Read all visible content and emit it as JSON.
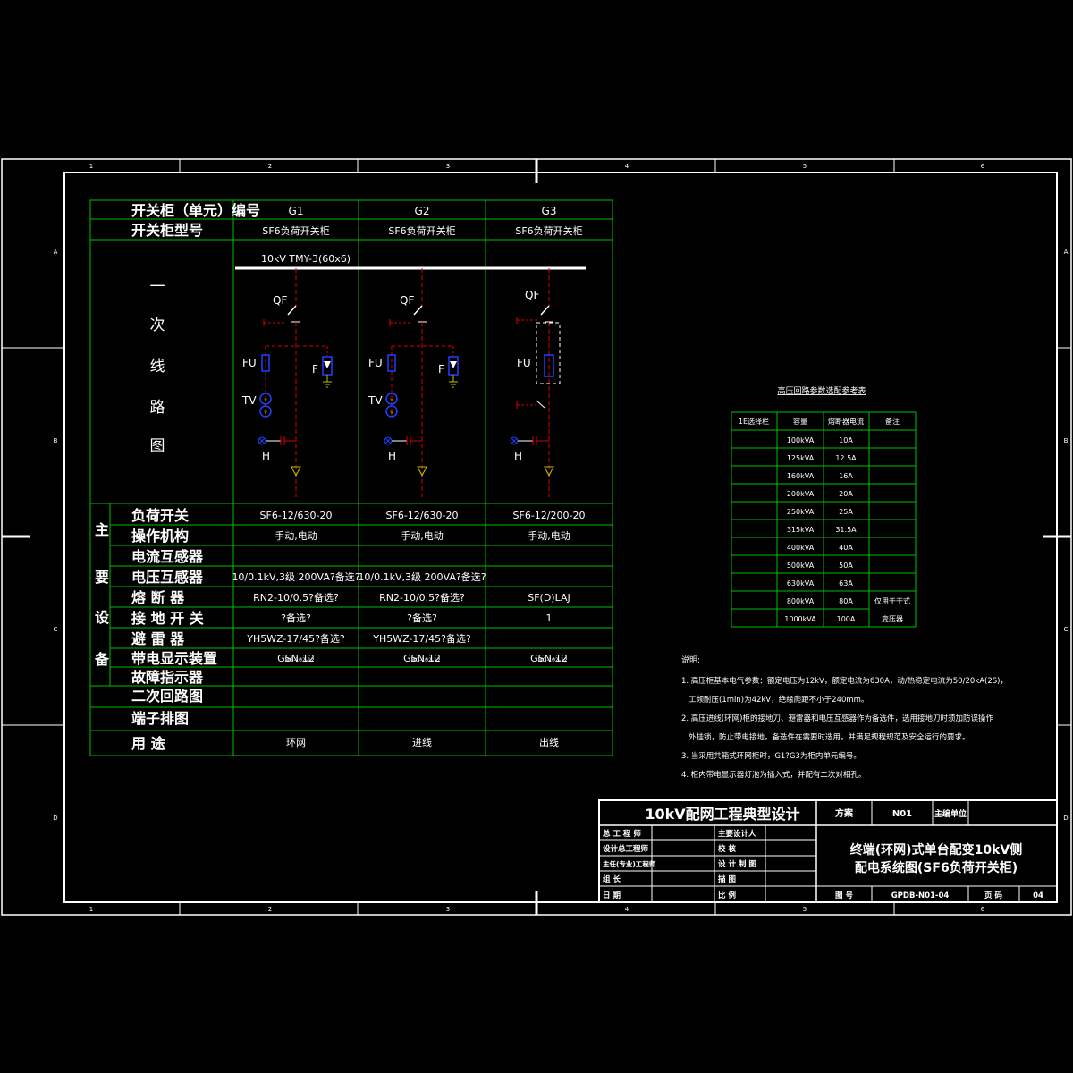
{
  "colors": {
    "background": "#000000",
    "frame": "#ffffff",
    "grid": "#00c000",
    "circuit": "#e00000",
    "device": "#2040ff",
    "ground_mark": "#c0c000",
    "text": "#ffffff"
  },
  "border": {
    "col_numbers": [
      "1",
      "2",
      "3",
      "4",
      "5",
      "6"
    ],
    "row_letters": [
      "A",
      "B",
      "C",
      "D"
    ]
  },
  "main_table": {
    "row_label_cabinet_id": "开关柜（单元）编号",
    "row_label_cabinet_model": "开关柜型号",
    "row_label_primary": [
      "一",
      "次",
      "线",
      "路",
      "图"
    ],
    "group_label": [
      "主",
      "要",
      "设",
      "备"
    ],
    "columns": [
      {
        "id": "G1",
        "model": "SF6负荷开关柜"
      },
      {
        "id": "G2",
        "model": "SF6负荷开关柜"
      },
      {
        "id": "G3",
        "model": "SF6负荷开关柜"
      }
    ],
    "equipment_rows": [
      {
        "label": "负荷开关",
        "values": [
          "SF6-12/630-20",
          "SF6-12/630-20",
          "SF6-12/200-20"
        ]
      },
      {
        "label": "操作机构",
        "values": [
          "手动,电动",
          "手动,电动",
          "手动,电动"
        ]
      },
      {
        "label": "电流互感器",
        "values": [
          "",
          "",
          ""
        ]
      },
      {
        "label": "电压互感器",
        "values": [
          "10/0.1kV,3级 200VA?备选?",
          "10/0.1kV,3级 200VA?备选?",
          ""
        ]
      },
      {
        "label": "熔 断 器",
        "values": [
          "RN2-10/0.5?备选?",
          "RN2-10/0.5?备选?",
          "SF(D)LAJ"
        ]
      },
      {
        "label": "接 地 开 关",
        "values": [
          "?备选?",
          "?备选?",
          "1"
        ]
      },
      {
        "label": "避 雷 器",
        "values": [
          "YH5WZ-17/45?备选?",
          "YH5WZ-17/45?备选?",
          ""
        ]
      },
      {
        "label": "带电显示装置",
        "values": [
          "GSN-12",
          "GSN-12",
          "GSN-12"
        ]
      },
      {
        "label": "故障指示器",
        "values": [
          "",
          "",
          ""
        ]
      }
    ],
    "gsn_suffix": [
      "MG-102-12",
      "MG-102-12",
      "MG-102-12"
    ],
    "bottom_rows": [
      {
        "label": "二次回路图",
        "values": [
          "",
          "",
          ""
        ]
      },
      {
        "label": "端子排图",
        "values": [
          "",
          "",
          ""
        ]
      },
      {
        "label": "用    途",
        "values": [
          "环网",
          "进线",
          "出线"
        ]
      }
    ]
  },
  "diagram": {
    "bus_label": "10kV  TMY-3(60x6)",
    "label_qf": "QF",
    "label_fu": "FU",
    "label_tv": "TV",
    "label_f": "F",
    "label_h": "H"
  },
  "ref_table": {
    "title": "高压回路参数选配参考表",
    "headers": [
      "1E选择栏",
      "容量",
      "熔断器电流",
      "备注"
    ],
    "rows": [
      {
        "capacity": "100kVA",
        "fuse": "10A",
        "note": ""
      },
      {
        "capacity": "125kVA",
        "fuse": "12.5A",
        "note": ""
      },
      {
        "capacity": "160kVA",
        "fuse": "16A",
        "note": ""
      },
      {
        "capacity": "200kVA",
        "fuse": "20A",
        "note": ""
      },
      {
        "capacity": "250kVA",
        "fuse": "25A",
        "note": ""
      },
      {
        "capacity": "315kVA",
        "fuse": "31.5A",
        "note": ""
      },
      {
        "capacity": "400kVA",
        "fuse": "40A",
        "note": ""
      },
      {
        "capacity": "500kVA",
        "fuse": "50A",
        "note": ""
      },
      {
        "capacity": "630kVA",
        "fuse": "63A",
        "note": ""
      },
      {
        "capacity": "800kVA",
        "fuse": "80A",
        "note": "仅用于干式"
      },
      {
        "capacity": "1000kVA",
        "fuse": "100A",
        "note": "变压器"
      }
    ]
  },
  "notes": {
    "heading": "说明:",
    "lines": [
      "1. 高压柜基本电气参数：额定电压为12kV，额定电流为630A，动/热稳定电流为50/20kA(2S)，",
      "工频耐压(1min)为42kV，绝缘爬距不小于240mm。",
      "2. 高压进线(环网)柜的接地刀、避雷器和电压互感器作为备选件，选用接地刀时须加防误操作",
      "外挂锁，防止带电接地，备选件在需要时选用，并满足规程规范及安全运行的要求。",
      "3. 当采用共箱式环网柜时，G1?G3为柜内单元编号。",
      "4. 柜内带电显示器灯泡为插入式，并配有二次对相孔。"
    ]
  },
  "title_block": {
    "project": "10kV配网工程典型设计",
    "scheme_label": "方案",
    "scheme_value": "N01",
    "unit_label": "主编单位",
    "roles_left": [
      "总 工 程 师",
      "设计总工程师",
      "主任(专业)工程师",
      "组    长",
      "日    期"
    ],
    "roles_right": [
      "主要设计人",
      "校    核",
      "设 计 制 图",
      "描    图",
      "比    例"
    ],
    "drawing_title_1": "终端(环网)式单台配变10kV侧",
    "drawing_title_2": "配电系统图(SF6负荷开关柜)",
    "drawing_no_label": "图    号",
    "drawing_no": "GPDB-N01-04",
    "page_label": "页    码",
    "page_no": "04"
  }
}
